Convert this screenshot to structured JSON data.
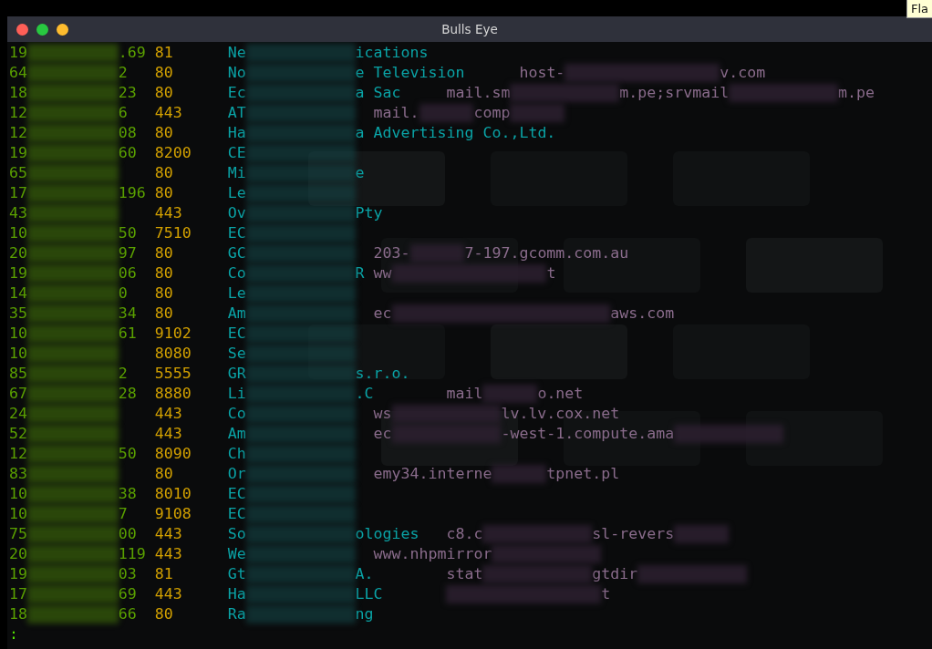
{
  "window": {
    "title": "Bulls Eye"
  },
  "tooltip": "Fla",
  "rows": [
    {
      "ip_head": "19",
      "ip_tail": ".69",
      "port": "81",
      "org_head": "Ne",
      "org_tail": "ications"
    },
    {
      "ip_head": "64",
      "ip_tail": "2",
      "port": "80",
      "org_head": "No",
      "org_tail": "e Television",
      "host": [
        {
          "kind": "text",
          "text": "host-"
        },
        {
          "kind": "redacted-long"
        },
        {
          "kind": "text",
          "text": "v.com"
        }
      ]
    },
    {
      "ip_head": "18",
      "ip_tail": "23",
      "port": "80",
      "org_head": "Ec",
      "org_tail": "a Sac",
      "host": [
        {
          "kind": "text",
          "text": "mail.sm"
        },
        {
          "kind": "redacted-medium"
        },
        {
          "kind": "text",
          "text": "m.pe;srvmail"
        },
        {
          "kind": "redacted-medium"
        },
        {
          "kind": "text",
          "text": "m.pe"
        }
      ]
    },
    {
      "ip_head": "12",
      "ip_tail": "6",
      "port": "443",
      "org_head": "AT",
      "host": [
        {
          "kind": "text",
          "text": "mail."
        },
        {
          "kind": "redacted-short"
        },
        {
          "kind": "text",
          "text": "comp"
        },
        {
          "kind": "redacted-short"
        }
      ]
    },
    {
      "ip_head": "12",
      "ip_tail": "08",
      "port": "80",
      "org_head": "Ha",
      "org_tail": "a Advertising Co.,Ltd."
    },
    {
      "ip_head": "19",
      "ip_tail": "60",
      "port": "8200",
      "org_head": "CE"
    },
    {
      "ip_head": "65",
      "port": "80",
      "org_head": "Mi",
      "org_tail": "e"
    },
    {
      "ip_head": "17",
      "ip_tail": "196",
      "port": "80",
      "org_head": "Le"
    },
    {
      "ip_head": "43",
      "port": "443",
      "org_head": "Ov",
      "org_tail": "Pty"
    },
    {
      "ip_head": "10",
      "ip_tail": "50",
      "port": "7510",
      "org_head": "EC"
    },
    {
      "ip_head": "20",
      "ip_tail": "97",
      "port": "80",
      "org_head": "GC",
      "host": [
        {
          "kind": "text",
          "text": "203-"
        },
        {
          "kind": "redacted-short"
        },
        {
          "kind": "text",
          "text": "7-197.gcomm.com.au"
        }
      ]
    },
    {
      "ip_head": "19",
      "ip_tail": "06",
      "port": "80",
      "org_head": "Co",
      "org_tail": "R",
      "host": [
        {
          "kind": "text",
          "text": "ww"
        },
        {
          "kind": "redacted-long"
        },
        {
          "kind": "text",
          "text": "t"
        }
      ]
    },
    {
      "ip_head": "14",
      "ip_tail": "0",
      "port": "80",
      "org_head": "Le"
    },
    {
      "ip_head": "35",
      "ip_tail": "34",
      "port": "80",
      "org_head": "Am",
      "host": [
        {
          "kind": "text",
          "text": "ec"
        },
        {
          "kind": "redacted-huge"
        },
        {
          "kind": "text",
          "text": "aws.com"
        }
      ]
    },
    {
      "ip_head": "10",
      "ip_tail": "61",
      "port": "9102",
      "org_head": "EC"
    },
    {
      "ip_head": "10",
      "port": "8080",
      "org_head": "Se"
    },
    {
      "ip_head": "85",
      "ip_tail": "2",
      "port": "5555",
      "org_head": "GR",
      "org_tail": "s.r.o."
    },
    {
      "ip_head": "67",
      "ip_tail": "28",
      "port": "8880",
      "org_head": "Li",
      "org_tail": ".C",
      "host": [
        {
          "kind": "text",
          "text": "mail"
        },
        {
          "kind": "redacted-short"
        },
        {
          "kind": "text",
          "text": "o.net"
        }
      ]
    },
    {
      "ip_head": "24",
      "port": "443",
      "org_head": "Co",
      "host": [
        {
          "kind": "text",
          "text": "ws"
        },
        {
          "kind": "redacted-medium"
        },
        {
          "kind": "text",
          "text": "lv.lv.cox.net"
        }
      ]
    },
    {
      "ip_head": "52",
      "port": "443",
      "org_head": "Am",
      "host": [
        {
          "kind": "text",
          "text": "ec"
        },
        {
          "kind": "redacted-medium"
        },
        {
          "kind": "text",
          "text": "-west-1.compute.ama"
        },
        {
          "kind": "redacted-medium"
        }
      ]
    },
    {
      "ip_head": "12",
      "ip_tail": "50",
      "port": "8090",
      "org_head": "Ch"
    },
    {
      "ip_head": "83",
      "port": "80",
      "org_head": "Or",
      "host": [
        {
          "kind": "text",
          "text": "emy34.interne"
        },
        {
          "kind": "redacted-short"
        },
        {
          "kind": "text",
          "text": "tpnet.pl"
        }
      ]
    },
    {
      "ip_head": "10",
      "ip_tail": "38",
      "port": "8010",
      "org_head": "EC"
    },
    {
      "ip_head": "10",
      "ip_tail": "7",
      "port": "9108",
      "org_head": "EC"
    },
    {
      "ip_head": "75",
      "ip_tail": "00",
      "port": "443",
      "org_head": "So",
      "org_tail": "ologies",
      "host": [
        {
          "kind": "text",
          "text": "c8.c"
        },
        {
          "kind": "redacted-medium"
        },
        {
          "kind": "text",
          "text": "sl-revers"
        },
        {
          "kind": "redacted-short"
        }
      ]
    },
    {
      "ip_head": "20",
      "ip_tail": "119",
      "port": "443",
      "org_head": "We",
      "host": [
        {
          "kind": "text",
          "text": "www.nhpmirror"
        },
        {
          "kind": "redacted-medium"
        }
      ]
    },
    {
      "ip_head": "19",
      "ip_tail": "03",
      "port": "81",
      "org_head": "Gt",
      "org_tail": "A.",
      "host": [
        {
          "kind": "text",
          "text": "stat"
        },
        {
          "kind": "redacted-medium"
        },
        {
          "kind": "text",
          "text": "gtdir"
        },
        {
          "kind": "redacted-medium"
        }
      ]
    },
    {
      "ip_head": "17",
      "ip_tail": "69",
      "port": "443",
      "org_head": "Ha",
      "org_tail": "LLC",
      "host": [
        {
          "kind": "redacted-long"
        },
        {
          "kind": "text",
          "text": "t"
        }
      ]
    },
    {
      "ip_head": "18",
      "ip_tail": "66",
      "port": "80",
      "org_head": "Ra",
      "org_tail": "ng"
    }
  ],
  "prompt": ":"
}
